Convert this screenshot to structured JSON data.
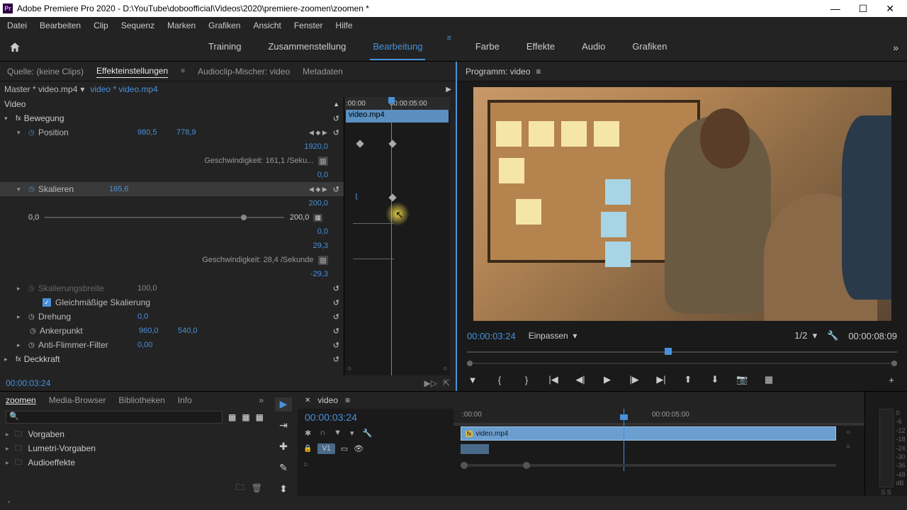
{
  "titlebar": {
    "app_badge": "Pr",
    "title": "Adobe Premiere Pro 2020 - D:\\YouTube\\doboofficial\\Videos\\2020\\premiere-zoomen\\zoomen *"
  },
  "menubar": [
    "Datei",
    "Bearbeiten",
    "Clip",
    "Sequenz",
    "Marken",
    "Grafiken",
    "Ansicht",
    "Fenster",
    "Hilfe"
  ],
  "workspace_tabs": [
    "Training",
    "Zusammenstellung",
    "Bearbeitung",
    "Farbe",
    "Effekte",
    "Audio",
    "Grafiken"
  ],
  "workspace_active": "Bearbeitung",
  "source_panel": {
    "tabs": [
      "Quelle: (keine Clips)",
      "Effekteinstellungen",
      "Audioclip-Mischer: video",
      "Metadaten"
    ],
    "active": "Effekteinstellungen",
    "master": "Master * video.mp4",
    "chain": "video * video.mp4",
    "clip_label": "video.mp4",
    "ruler_start": ":00:00",
    "ruler_mid": "00:00:05:00",
    "section_video": "Video",
    "bewegung": "Bewegung",
    "position": "Position",
    "position_x": "980,5",
    "position_y": "778,9",
    "pos_max": "1920,0",
    "pos_speed": "Geschwindigkeit: 161,1 /Seku...",
    "pos_zero": "0,0",
    "skalieren": "Skalieren",
    "skalieren_val": "165,6",
    "slider_min": "0,0",
    "slider_max": "200,0",
    "sk_200": "200,0",
    "sk_zero": "0,0",
    "sk_293": "29,3",
    "sk_speed": "Geschwindigkeit: 28,4 /Sekunde",
    "sk_neg293": "-29,3",
    "skalierungsbreite": "Skalierungsbreite",
    "skalierungsbreite_val": "100,0",
    "gleichmassig": "Gleichmäßige Skalierung",
    "drehung": "Drehung",
    "drehung_val": "0,0",
    "ankerpunkt": "Ankerpunkt",
    "anker_x": "960,0",
    "anker_y": "540,0",
    "antiflimmer": "Anti-Flimmer-Filter",
    "antiflimmer_val": "0,00",
    "deckkraft": "Deckkraft",
    "footer_time": "00:00:03:24"
  },
  "program_panel": {
    "title": "Programm: video",
    "current_time": "00:00:03:24",
    "fit": "Einpassen",
    "zoom_level": "1/2",
    "duration": "00:00:08:09"
  },
  "project_panel": {
    "tabs": [
      "zoomen",
      "Media-Browser",
      "Bibliotheken",
      "Info"
    ],
    "active": "zoomen",
    "items": [
      "Vorgaben",
      "Lumetri-Vorgaben",
      "Audioeffekte"
    ]
  },
  "timeline_panel": {
    "seq_name": "video",
    "time": "00:00:03:24",
    "ruler_start": ":00:00",
    "ruler_mid": "00:00:05:00",
    "track_v1": "V1",
    "clip_name": "video.mp4"
  },
  "audio_meter": {
    "labels": [
      "0",
      "-6",
      "-12",
      "-18",
      "-24",
      "-30",
      "-36",
      "-48",
      "dB"
    ],
    "solo": "S  S"
  },
  "icons": {
    "reset": "↺",
    "stopwatch": "◷",
    "diamond": "◆",
    "play": "▶",
    "chev_down": "▾",
    "chev_right": "▸",
    "chev_more": "»",
    "fx": "fx",
    "check": "✓",
    "lock": "🔒",
    "eye": "👁",
    "search": "🔍",
    "home": "⌂",
    "menu": "≡",
    "x": "✕",
    "min": "—",
    "max": "☐"
  }
}
